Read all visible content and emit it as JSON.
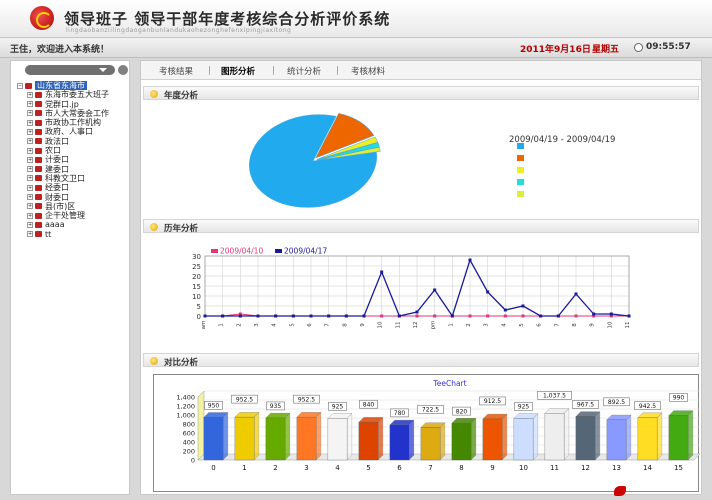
{
  "app": {
    "title": "领导班子 领导干部年度考核综合分析评价系统",
    "pinyin": "lingdaobanziilingdaoganbunlandukaohezonghefenxipingjiaxitong"
  },
  "infobar": {
    "welcome": "王住，欢迎进入本系统！",
    "date": "2011年9月16日",
    "weekday": "星期五",
    "time": "09:55:57"
  },
  "tree": {
    "root": "山东省东海市",
    "items": [
      "东海市委五大班子",
      "党群口.jp",
      "市人大常委会工作",
      "市政协工作机构",
      "政府、人事口",
      "政法口",
      "农口",
      "计委口",
      "建委口",
      "科教文卫口",
      "经委口",
      "财委口",
      "县(市)区",
      "企干处管理",
      "aaaa",
      "tt"
    ]
  },
  "tabs": [
    "考核结果",
    "图形分析",
    "统计分析",
    "考核材料"
  ],
  "active_tab": 1,
  "panels": {
    "year": {
      "title": "年度分析",
      "range": "2009/04/19 - 2009/04/19"
    },
    "history": {
      "title": "历年分析"
    },
    "compare": {
      "title": "对比分析"
    }
  },
  "colors": {
    "accent_red": "#b00000",
    "tree_selected": "#2e63b8",
    "pie_main": "#22aaee",
    "pie_orange": "#ee6600",
    "pie_yellow": "#eeee22",
    "pie_teal": "#22dddd",
    "line_pink": "#e0357a",
    "line_navy": "#1a1a99",
    "teechart_title": "#3333cc"
  },
  "chart_data": [
    {
      "type": "pie",
      "title": "",
      "legend": {
        "placement": "right",
        "header": "2009/04/19 - 2009/04/19"
      },
      "slices": [
        {
          "value": 82.5,
          "color": "#22aaee"
        },
        {
          "value": 12.5,
          "color": "#ee6600"
        },
        {
          "value": 2.0,
          "color": "#eeee22"
        },
        {
          "value": 1.5,
          "color": "#22dddd"
        },
        {
          "value": 1.5,
          "color": "#ddee33"
        }
      ]
    },
    {
      "type": "line",
      "title": "",
      "legend_placement": "top-left",
      "ylim": [
        0,
        30
      ],
      "yticks": [
        "30",
        "25",
        "20",
        "15",
        "10",
        "5",
        "0"
      ],
      "grid": true,
      "xticks": [
        "am",
        "1",
        "2",
        "3",
        "4",
        "5",
        "6",
        "7",
        "8",
        "9",
        "10",
        "11",
        "12",
        "pm",
        "1",
        "2",
        "3",
        "4",
        "5",
        "6",
        "7",
        "8",
        "9",
        "10",
        "11"
      ],
      "series": [
        {
          "name": "2009/04/10",
          "color": "#e0357a",
          "values": [
            0,
            0,
            1,
            0,
            0,
            0,
            0,
            0,
            0,
            0,
            0,
            0,
            0,
            0,
            0,
            0,
            0,
            0,
            0,
            0,
            0,
            0,
            0,
            0,
            0
          ]
        },
        {
          "name": "2009/04/17",
          "color": "#1a1a99",
          "values": [
            0,
            0,
            0,
            0,
            0,
            0,
            0,
            0,
            0,
            0,
            22,
            0,
            2,
            13,
            0,
            28,
            12,
            3,
            5,
            0,
            0,
            11,
            1,
            1,
            0
          ]
        }
      ]
    },
    {
      "type": "bar",
      "title": "TeeChart",
      "ylim": [
        0,
        1400
      ],
      "yticks": [
        "1,400",
        "1,200",
        "1,000",
        "800",
        "600",
        "400",
        "200",
        "0"
      ],
      "categories": [
        "0",
        "1",
        "2",
        "3",
        "4",
        "5",
        "6",
        "7",
        "8",
        "9",
        "10",
        "11",
        "12",
        "13",
        "14",
        "15"
      ],
      "labels": [
        "950",
        "952.5",
        "935",
        "952.5",
        "925",
        "840",
        "780",
        "722.5",
        "820",
        "912.5",
        "925",
        "1,037.5",
        "967.5",
        "892.5",
        "942.5",
        "990"
      ],
      "values": [
        950,
        952.5,
        935,
        952.5,
        925,
        840,
        780,
        722.5,
        820,
        912.5,
        925,
        1037.5,
        967.5,
        892.5,
        942.5,
        990
      ],
      "colors": [
        "#3366dd",
        "#eecc00",
        "#66aa00",
        "#ff7722",
        "#f4f4f4",
        "#dd4400",
        "#2233cc",
        "#ddaa11",
        "#448800",
        "#ee5500",
        "#ccddff",
        "#eeeeee",
        "#556677",
        "#8899ff",
        "#ffdd22",
        "#44aa11"
      ]
    }
  ]
}
